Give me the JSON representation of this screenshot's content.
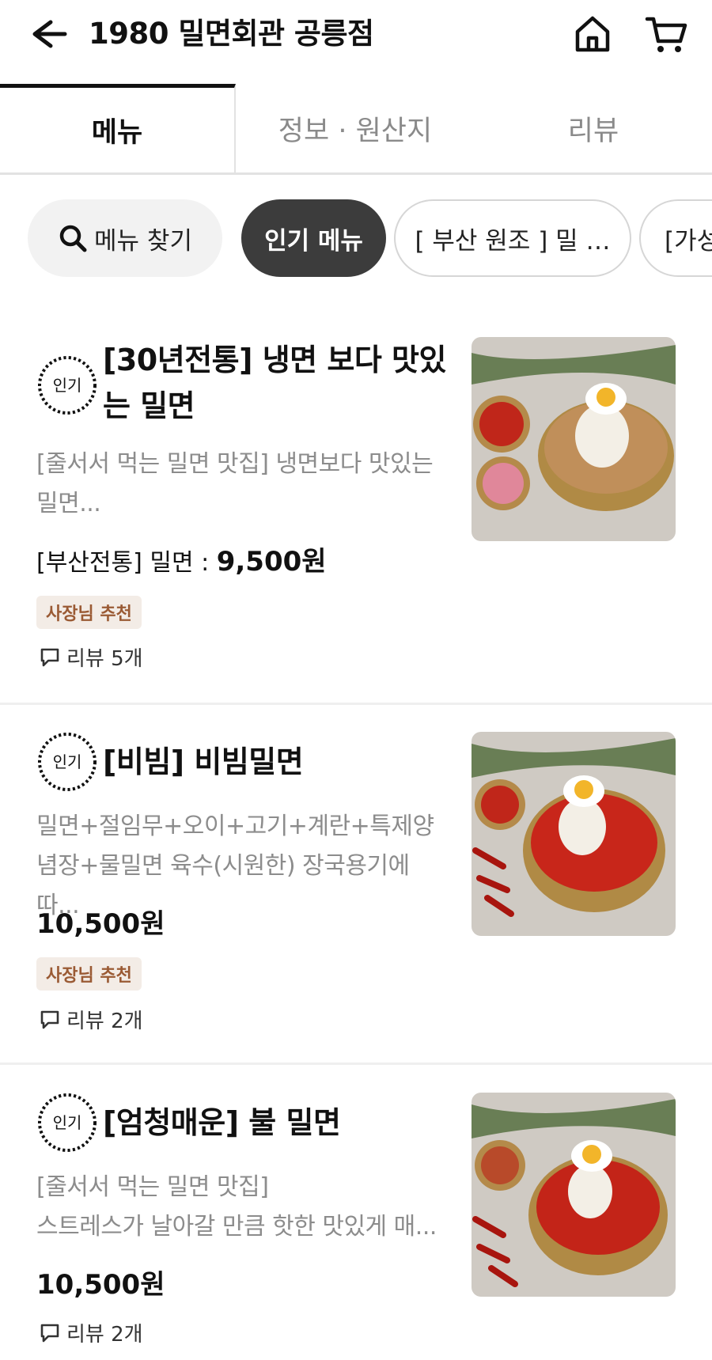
{
  "header": {
    "title": "1980 밀면회관 공릉점",
    "back_icon": "arrow-left-icon",
    "home_icon": "home-icon",
    "cart_icon": "cart-icon"
  },
  "tabs": [
    {
      "label": "메뉴",
      "active": true
    },
    {
      "label": "정보 · 원산지",
      "active": false
    },
    {
      "label": "리뷰",
      "active": false
    }
  ],
  "chips": {
    "search_label": "메뉴 찾기",
    "popular_label": "인기 메뉴",
    "busan_label": "[ 부산 원조 ]  밀  …",
    "value_label": "[가성"
  },
  "badge_label": "인기",
  "items": [
    {
      "name": "[30년전통] 냉면 보다 맛있는 밀면",
      "desc": "[줄서서 먹는 밀면 맛집] 냉면보다 맛있는 밀면...",
      "price_prefix": "[부산전통] 밀면 : ",
      "price": "9,500원",
      "owner_tag": "사장님 추천",
      "reviews": "리뷰 5개"
    },
    {
      "name": "[비빔] 비빔밀면",
      "desc": "밀면+절임무+오이+고기+계란+특제양념장+물밀면 육수(시원한) 장국용기에 따...",
      "price": "10,500원",
      "owner_tag": "사장님 추천",
      "reviews": "리뷰 2개"
    },
    {
      "name": "[엄청매운] 불 밀면",
      "desc_line1": "[줄서서 먹는 밀면 맛집]",
      "desc_line2": "스트레스가 날아갈 만큼 핫한 맛있게 매...",
      "price": "10,500원",
      "reviews": "리뷰 2개"
    }
  ],
  "colors": {
    "accent_dark": "#3c3c3c",
    "tag_bg": "#f3ece6",
    "tag_text": "#9a5a34"
  }
}
